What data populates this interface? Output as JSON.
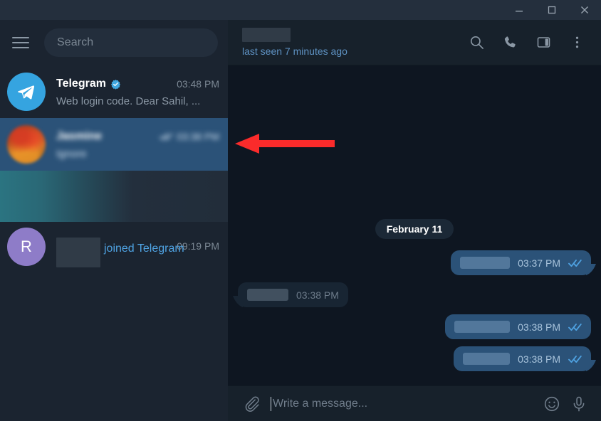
{
  "window": {
    "controls": [
      {
        "name": "minimize",
        "glyph": "minimize-icon"
      },
      {
        "name": "maximize",
        "glyph": "maximize-icon"
      },
      {
        "name": "close",
        "glyph": "close-icon"
      }
    ]
  },
  "colors": {
    "titlebar_bg": "#242f3d",
    "sidebar_bg": "#1b2430",
    "chat_bg": "#0e1621",
    "header_bg": "#17212b",
    "selected_row": "#2b5278",
    "bubble_out": "#2b5278",
    "bubble_in": "#182533",
    "accent_blue": "#4fa3e3",
    "telegram_blue": "#35a4e0",
    "avatar_purple": "#8e7cc8",
    "annotation_red": "#fa2b2b",
    "link_blue": "#4fa3e3"
  },
  "sidebar": {
    "menu_icon": "hamburger-icon",
    "search": {
      "placeholder": "Search",
      "value": ""
    },
    "chats": [
      {
        "id": "telegram",
        "avatar_type": "telegram-logo",
        "name": "Telegram",
        "verified": true,
        "time": "03:48 PM",
        "preview": "Web login code. Dear Sahil, ...",
        "selected": false,
        "redacted": false
      },
      {
        "id": "jasmine",
        "avatar_type": "photo",
        "name": "Jasmine",
        "verified": false,
        "time": "03:38 PM",
        "preview": "Ignore",
        "selected": true,
        "redacted": true,
        "outgoing_ticks": true
      },
      {
        "id": "gradient-placeholder",
        "avatar_type": "none",
        "name": "",
        "time": "",
        "preview": "",
        "selected": false,
        "redacted": true,
        "is_gradient_block": true
      },
      {
        "id": "joined",
        "avatar_type": "letter",
        "avatar_letter": "R",
        "name": "",
        "time": "09:19 PM",
        "preview": "joined Telegram",
        "selected": false,
        "redacted": true,
        "name_redacted": true
      }
    ]
  },
  "chat": {
    "header": {
      "peer_name": "",
      "peer_name_redacted": true,
      "status": "last seen 7 minutes ago",
      "actions": [
        {
          "name": "search-icon",
          "label": "Search"
        },
        {
          "name": "phone-icon",
          "label": "Call"
        },
        {
          "name": "panel-icon",
          "label": "Info"
        },
        {
          "name": "more-vertical-icon",
          "label": "More"
        }
      ]
    },
    "date_separator": "February 11",
    "messages": [
      {
        "direction": "out",
        "text": "",
        "text_redacted": true,
        "time": "03:37 PM",
        "status": "read",
        "ticks": "double-check-icon",
        "tail": true,
        "redact_width": 70
      },
      {
        "direction": "in",
        "text": "",
        "text_redacted": true,
        "time": "03:38 PM",
        "status": "",
        "ticks": "",
        "tail": true,
        "redact_width": 58
      },
      {
        "direction": "out",
        "text": "",
        "text_redacted": true,
        "time": "03:38 PM",
        "status": "read",
        "ticks": "double-check-icon",
        "tail": false,
        "redact_width": 78
      },
      {
        "direction": "out",
        "text": "",
        "text_redacted": true,
        "time": "03:38 PM",
        "status": "read",
        "ticks": "double-check-icon",
        "tail": true,
        "redact_width": 66
      }
    ],
    "composer": {
      "attach_icon": "paperclip-icon",
      "placeholder": "Write a message...",
      "value": "",
      "emoji_icon": "smiley-icon",
      "mic_icon": "microphone-icon"
    }
  },
  "annotation": {
    "type": "arrow",
    "direction": "left",
    "color": "#fa2b2b",
    "points_to": "selected-chat-row"
  }
}
